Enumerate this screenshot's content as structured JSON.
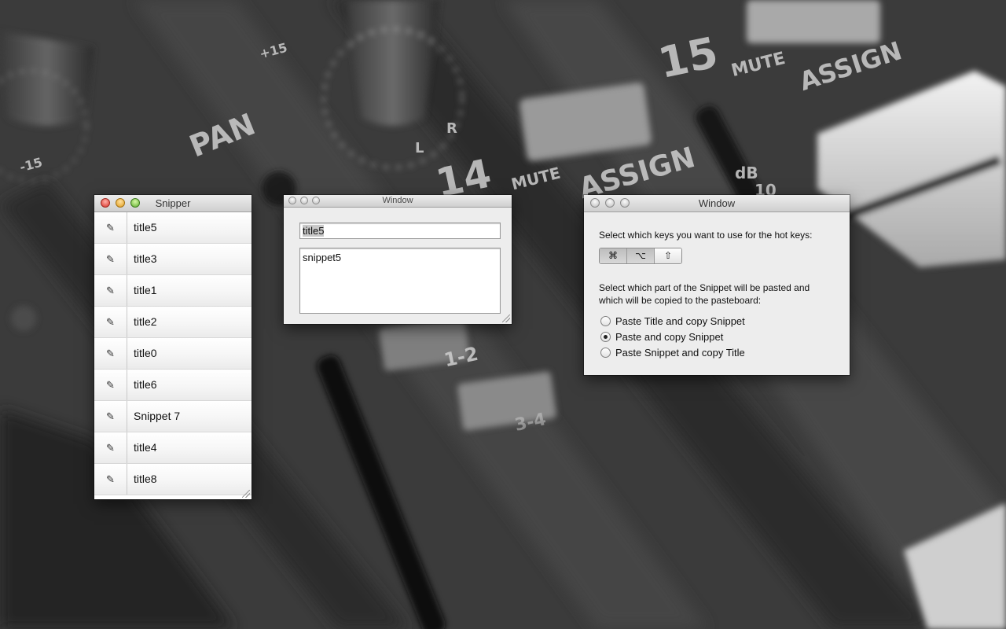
{
  "wallpaper": {
    "labels": [
      "PAN",
      "-15",
      "+15",
      "L",
      "R",
      "15",
      "MUTE",
      "ASSIGN",
      "14",
      "MUTE",
      "ASSIGN",
      "dB",
      "10",
      "1-2",
      "3-4"
    ]
  },
  "snipper_window": {
    "title": "Snipper",
    "edit_glyph": "✎",
    "rows": [
      {
        "title": "title5"
      },
      {
        "title": "title3"
      },
      {
        "title": "title1"
      },
      {
        "title": "title2"
      },
      {
        "title": "title0"
      },
      {
        "title": "title6"
      },
      {
        "title": "Snippet 7"
      },
      {
        "title": "title4"
      },
      {
        "title": "title8"
      }
    ]
  },
  "editor_window": {
    "title": "Window",
    "title_field_value": "title5",
    "snippet_value": "snippet5"
  },
  "prefs_window": {
    "title": "Window",
    "hotkey_label": "Select which keys you want to use for the hot keys:",
    "hotkeys": [
      {
        "glyph": "⌘",
        "name": "command-key",
        "selected": true
      },
      {
        "glyph": "⌥",
        "name": "option-key",
        "selected": true
      },
      {
        "glyph": "⇧",
        "name": "shift-key",
        "selected": false
      }
    ],
    "paste_label_line1": "Select which part of the Snippet will be pasted and",
    "paste_label_line2": "which will be copied to the pasteboard:",
    "options": [
      {
        "label": "Paste Title and copy Snippet",
        "checked": false
      },
      {
        "label": "Paste and copy Snippet",
        "checked": true
      },
      {
        "label": "Paste Snippet and copy Title",
        "checked": false
      }
    ]
  }
}
